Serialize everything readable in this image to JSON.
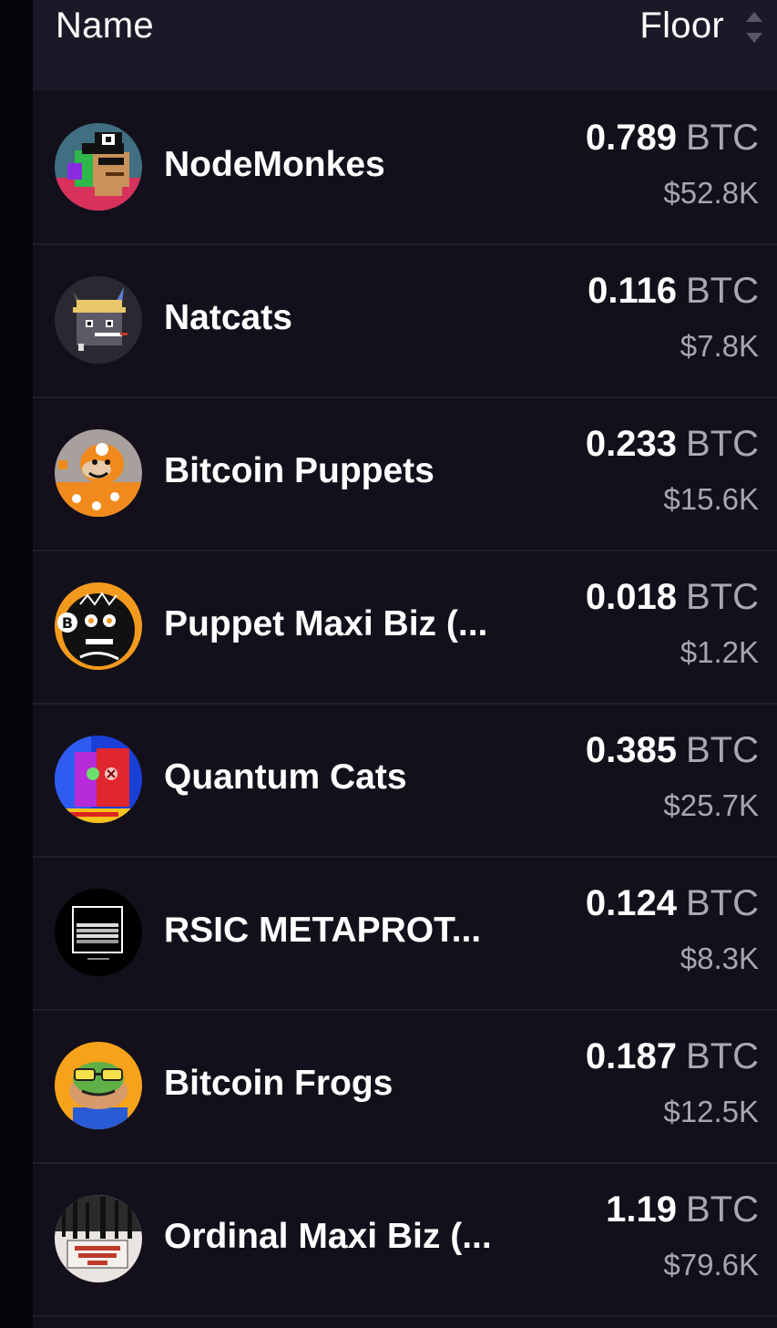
{
  "header": {
    "name_label": "Name",
    "floor_label": "Floor"
  },
  "rows": [
    {
      "name": "NodeMonkes",
      "btc": "0.789",
      "unit": "BTC",
      "usd": "$52.8K",
      "icon": "nodemonkes-avatar-icon"
    },
    {
      "name": "Natcats",
      "btc": "0.116",
      "unit": "BTC",
      "usd": "$7.8K",
      "icon": "natcats-avatar-icon"
    },
    {
      "name": "Bitcoin Puppets",
      "btc": "0.233",
      "unit": "BTC",
      "usd": "$15.6K",
      "icon": "bitcoin-puppets-avatar-icon"
    },
    {
      "name": "Puppet Maxi Biz (...",
      "btc": "0.018",
      "unit": "BTC",
      "usd": "$1.2K",
      "icon": "puppet-maxi-biz-avatar-icon"
    },
    {
      "name": "Quantum Cats",
      "btc": "0.385",
      "unit": "BTC",
      "usd": "$25.7K",
      "icon": "quantum-cats-avatar-icon"
    },
    {
      "name": "RSIC METAPROT...",
      "btc": "0.124",
      "unit": "BTC",
      "usd": "$8.3K",
      "icon": "rsic-metaprotocol-avatar-icon"
    },
    {
      "name": "Bitcoin Frogs",
      "btc": "0.187",
      "unit": "BTC",
      "usd": "$12.5K",
      "icon": "bitcoin-frogs-avatar-icon"
    },
    {
      "name": "Ordinal Maxi Biz (...",
      "btc": "1.19",
      "unit": "BTC",
      "usd": "$79.6K",
      "icon": "ordinal-maxi-biz-avatar-icon"
    }
  ],
  "colors": {
    "background": "#13101b",
    "header": "#1c1827",
    "divider": "#221e2d",
    "muted_text": "#aaa6b5"
  }
}
